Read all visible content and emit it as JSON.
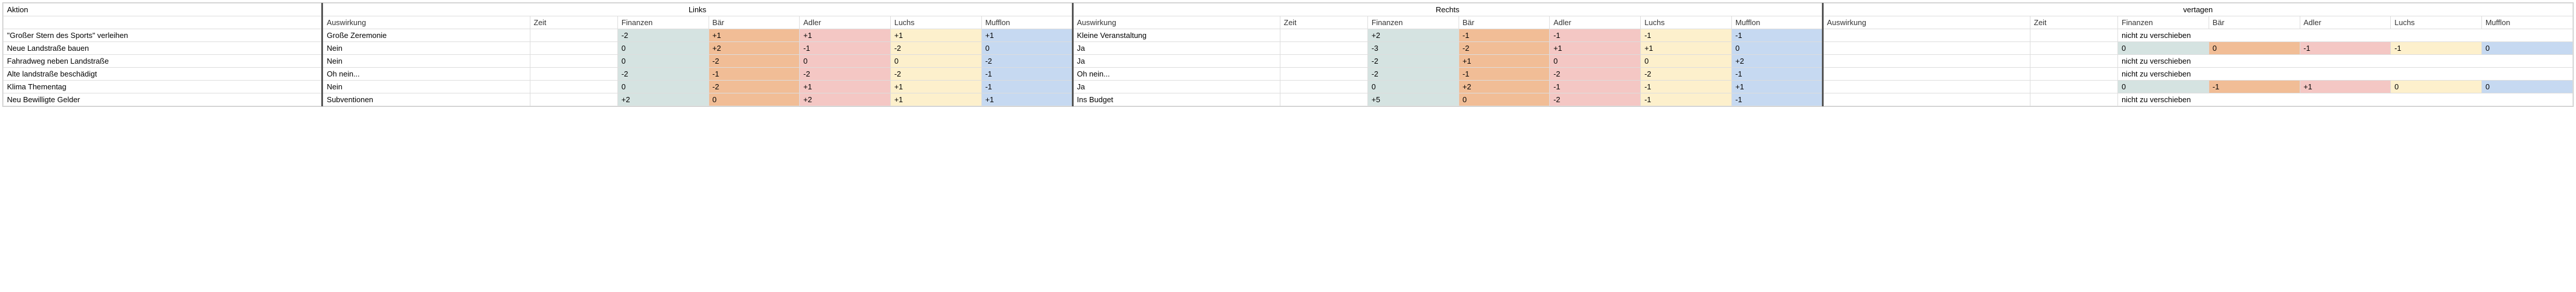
{
  "headers": {
    "aktion": "Aktion",
    "links": "Links",
    "rechts": "Rechts",
    "vertagen": "vertagen",
    "auswirkung": "Auswirkung",
    "zeit": "Zeit",
    "finanzen": "Finanzen",
    "baer": "Bär",
    "adler": "Adler",
    "luchs": "Luchs",
    "mufflon": "Mufflon"
  },
  "not_deferrable": "nicht zu verschieben",
  "rows": [
    {
      "aktion": "\"Großer Stern des Sports\" verleihen",
      "links": {
        "auswirkung": "Große Zeremonie",
        "zeit": "",
        "fin": "-2",
        "baer": "+1",
        "adler": "+1",
        "luchs": "+1",
        "mufflon": "+1"
      },
      "rechts": {
        "auswirkung": "Kleine Veranstaltung",
        "zeit": "",
        "fin": "+2",
        "baer": "-1",
        "adler": "-1",
        "luchs": "-1",
        "mufflon": "-1"
      },
      "vertagen": {
        "deferrable": false
      }
    },
    {
      "aktion": "Neue Landstraße bauen",
      "links": {
        "auswirkung": "Nein",
        "zeit": "",
        "fin": "0",
        "baer": "+2",
        "adler": "-1",
        "luchs": "-2",
        "mufflon": "0"
      },
      "rechts": {
        "auswirkung": "Ja",
        "zeit": "",
        "fin": "-3",
        "baer": "-2",
        "adler": "+1",
        "luchs": "+1",
        "mufflon": "0"
      },
      "vertagen": {
        "deferrable": true,
        "auswirkung": "",
        "zeit": "",
        "fin": "0",
        "baer": "0",
        "adler": "-1",
        "luchs": "-1",
        "mufflon": "0"
      }
    },
    {
      "aktion": "Fahradweg neben Landstraße",
      "links": {
        "auswirkung": "Nein",
        "zeit": "",
        "fin": "0",
        "baer": "-2",
        "adler": "0",
        "luchs": "0",
        "mufflon": "-2"
      },
      "rechts": {
        "auswirkung": "Ja",
        "zeit": "",
        "fin": "-2",
        "baer": "+1",
        "adler": "0",
        "luchs": "0",
        "mufflon": "+2"
      },
      "vertagen": {
        "deferrable": false
      }
    },
    {
      "aktion": "Alte landstraße beschädigt",
      "links": {
        "auswirkung": "Oh nein...",
        "zeit": "",
        "fin": "-2",
        "baer": "-1",
        "adler": "-2",
        "luchs": "-2",
        "mufflon": "-1"
      },
      "rechts": {
        "auswirkung": "Oh nein...",
        "zeit": "",
        "fin": "-2",
        "baer": "-1",
        "adler": "-2",
        "luchs": "-2",
        "mufflon": "-1"
      },
      "vertagen": {
        "deferrable": false
      }
    },
    {
      "aktion": "Klima Thementag",
      "links": {
        "auswirkung": "Nein",
        "zeit": "",
        "fin": "0",
        "baer": "-2",
        "adler": "+1",
        "luchs": "+1",
        "mufflon": "-1"
      },
      "rechts": {
        "auswirkung": "Ja",
        "zeit": "",
        "fin": "0",
        "baer": "+2",
        "adler": "-1",
        "luchs": "-1",
        "mufflon": "+1"
      },
      "vertagen": {
        "deferrable": true,
        "auswirkung": "",
        "zeit": "",
        "fin": "0",
        "baer": "-1",
        "adler": "+1",
        "luchs": "0",
        "mufflon": "0"
      }
    },
    {
      "aktion": "Neu Bewilligte Gelder",
      "links": {
        "auswirkung": "Subventionen",
        "zeit": "",
        "fin": "+2",
        "baer": "0",
        "adler": "+2",
        "luchs": "+1",
        "mufflon": "+1"
      },
      "rechts": {
        "auswirkung": "Ins Budget",
        "zeit": "",
        "fin": "+5",
        "baer": "0",
        "adler": "-2",
        "luchs": "-1",
        "mufflon": "-1"
      },
      "vertagen": {
        "deferrable": false
      }
    }
  ]
}
